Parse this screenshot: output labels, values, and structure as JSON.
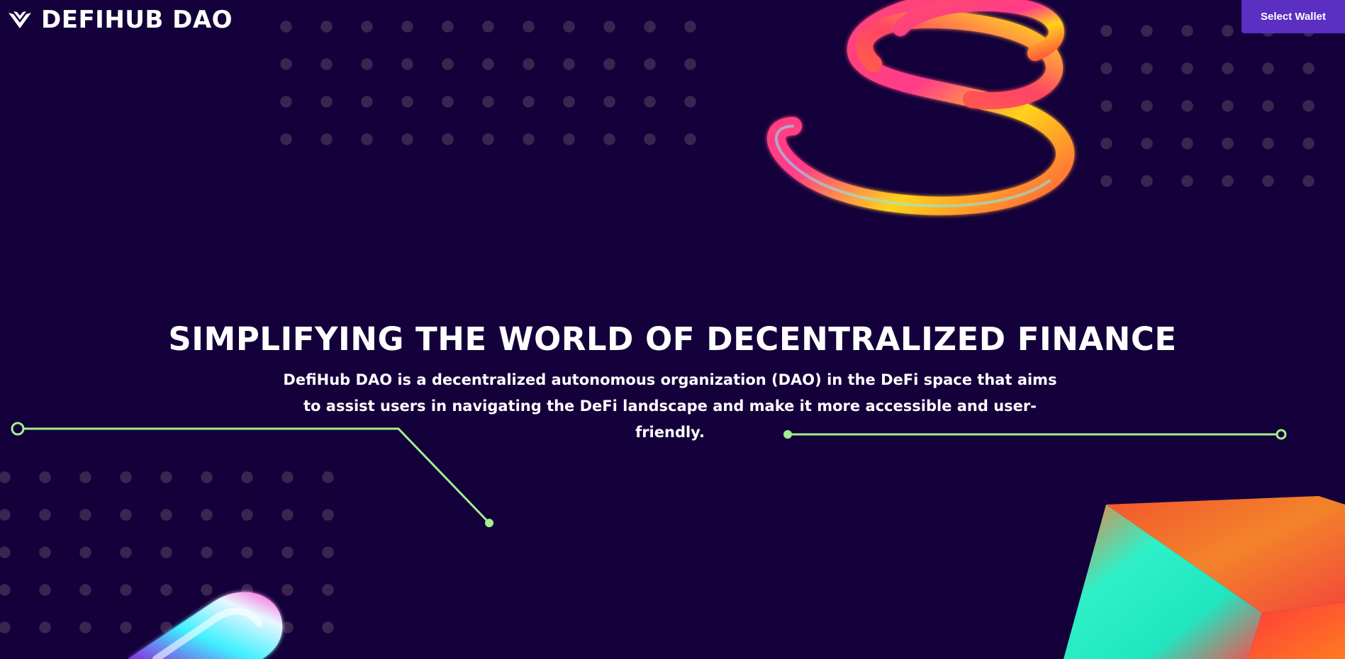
{
  "header": {
    "brand": "DEFIHUB DAO",
    "logo_icon": "winged-chevron-logo-icon",
    "wallet_button_label": "Select Wallet"
  },
  "hero": {
    "title": "SIMPLIFYING THE WORLD OF DECENTRALIZED FINANCE",
    "description": "DefiHub DAO is a decentralized autonomous organization (DAO) in the DeFi space that aims to assist users in navigating the DeFi landscape and make it more accessible and user-friendly."
  },
  "colors": {
    "background": "#14003a",
    "accent_button": "#5a2fc2",
    "circuit_line": "#a4ee8f",
    "dot": "#3c2450",
    "text": "#ffffff"
  },
  "decorations": [
    "neon-coil-art",
    "neon-capsule-art",
    "gradient-cube-art",
    "circuit-line-left",
    "circuit-line-right"
  ]
}
